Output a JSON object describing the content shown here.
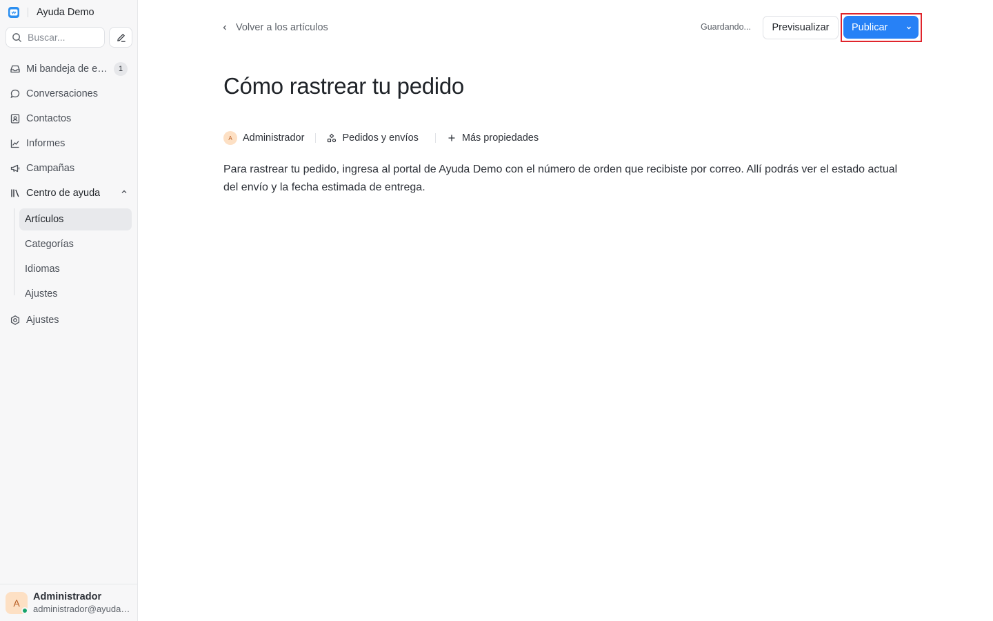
{
  "app": {
    "name": "Ayuda Demo"
  },
  "search": {
    "placeholder": "Buscar..."
  },
  "sidebar": {
    "inbox": {
      "label": "Mi bandeja de entrada",
      "count": "1"
    },
    "conversations": "Conversaciones",
    "contacts": "Contactos",
    "reports": "Informes",
    "campaigns": "Campañas",
    "help_center": "Centro de ayuda",
    "help_center_items": [
      "Artículos",
      "Categorías",
      "Idiomas",
      "Ajustes"
    ],
    "settings": "Ajustes"
  },
  "user": {
    "initial": "A",
    "name": "Administrador",
    "email": "administrador@ayudademo.com",
    "status_color": "#16a36a"
  },
  "header": {
    "back_label": "Volver a los artículos",
    "status": "Guardando...",
    "preview_label": "Previsualizar",
    "publish_label": "Publicar"
  },
  "article": {
    "title": "Cómo rastrear tu pedido",
    "author_initial": "A",
    "author": "Administrador",
    "category": "Pedidos y envíos",
    "more_properties": "Más propiedades",
    "body": "Para rastrear tu pedido, ingresa al portal de Ayuda Demo con el número de orden que recibiste por correo. Allí podrás ver el estado actual del envío y la fecha estimada de entrega."
  },
  "colors": {
    "accent": "#2781f6",
    "highlight": "#e0242b"
  }
}
